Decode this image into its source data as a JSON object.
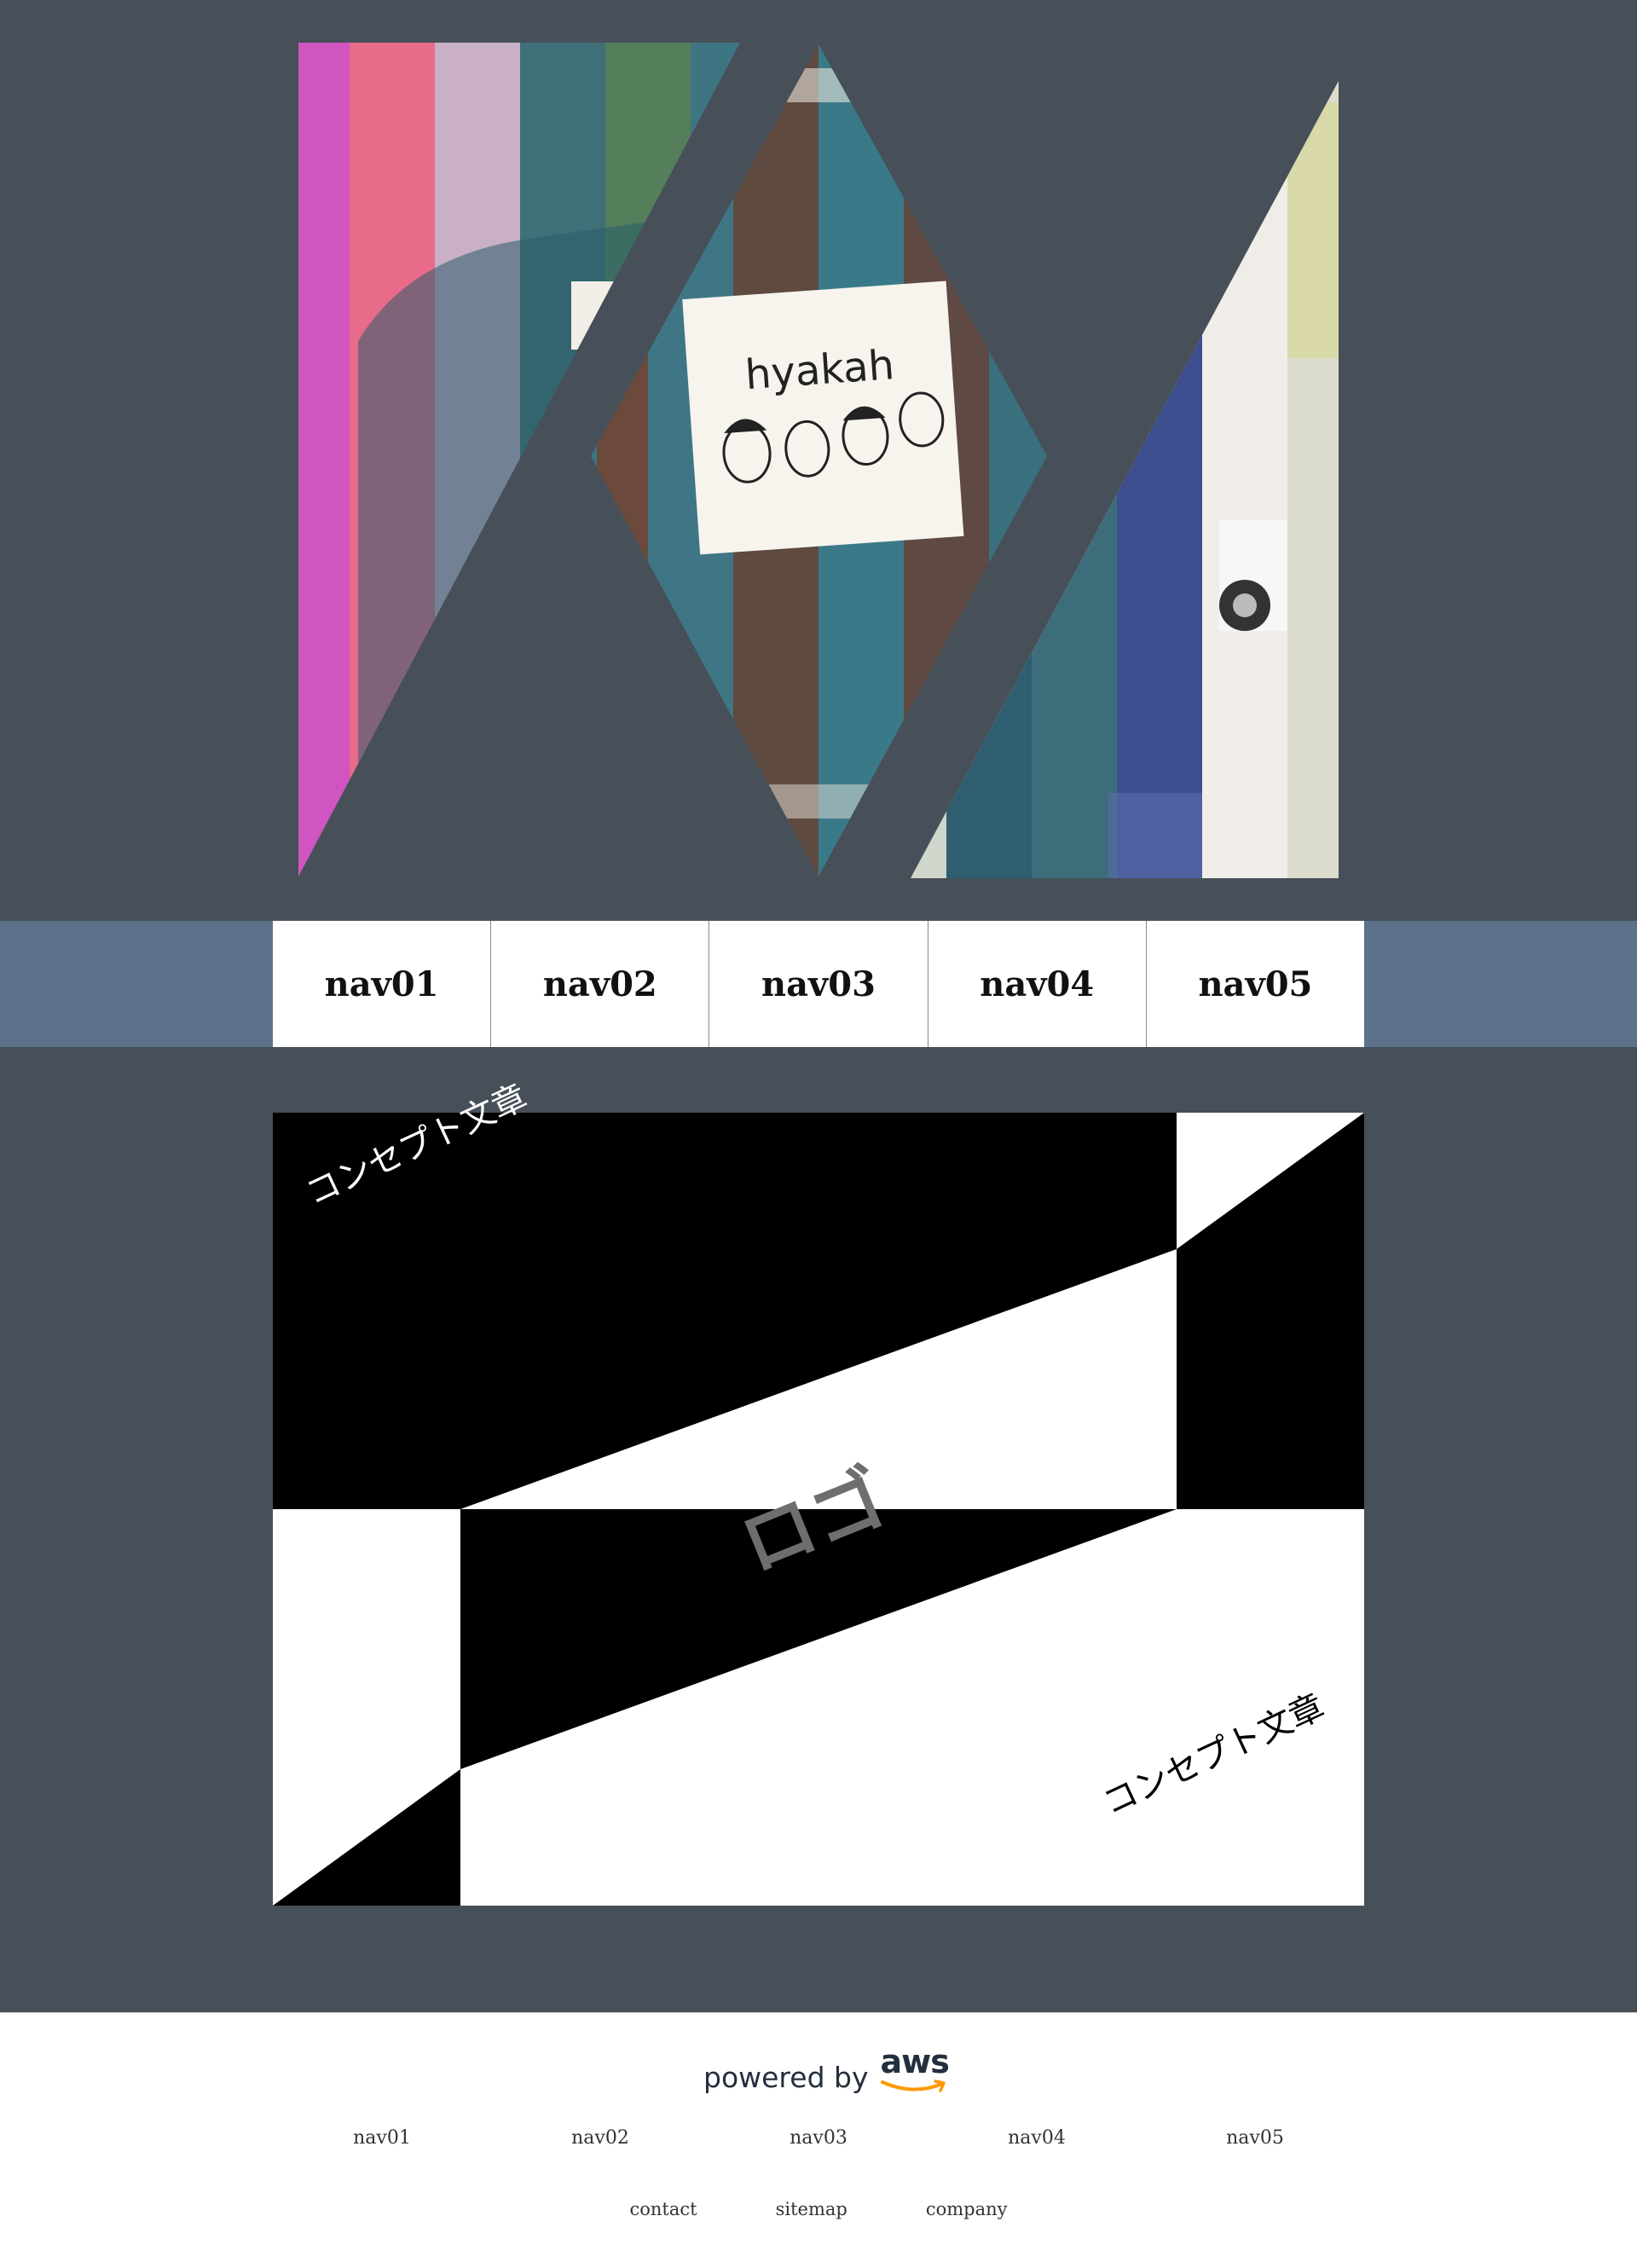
{
  "colors": {
    "background": "#474f59",
    "navbar": "#5d718a",
    "footer": "#ffffff",
    "aws_orange": "#ff9900",
    "aws_navy": "#232f3e"
  },
  "hero": {
    "image_alt": "denim jacket collage",
    "patch_text": "hyakah"
  },
  "nav": {
    "items": [
      "nav01",
      "nav02",
      "nav03",
      "nav04",
      "nav05"
    ]
  },
  "concept": {
    "text_top": "コンセプト文章",
    "text_bottom": "コンセプト文章",
    "logo": "ロゴ"
  },
  "footer": {
    "powered_by": "powered by",
    "aws": "aws",
    "nav": [
      "nav01",
      "nav02",
      "nav03",
      "nav04",
      "nav05"
    ],
    "links": [
      "contact",
      "sitemap",
      "company"
    ]
  }
}
